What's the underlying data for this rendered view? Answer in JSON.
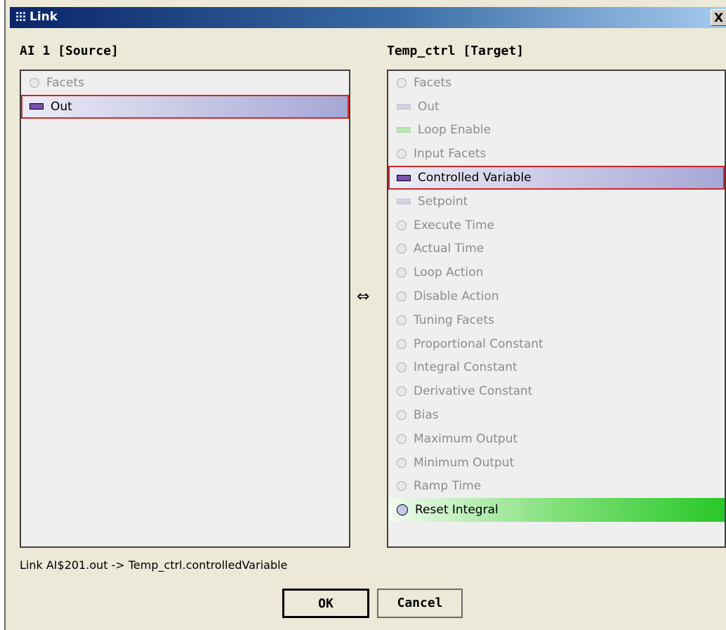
{
  "window": {
    "title": "Link",
    "close_label": "X"
  },
  "source": {
    "heading": "AI 1 [Source]",
    "items": [
      {
        "label": "Facets",
        "icon": "circle-icon",
        "state": "normal"
      },
      {
        "label": "Out",
        "icon": "bar-icon",
        "state": "selected"
      }
    ]
  },
  "link_arrow": "⇔",
  "target": {
    "heading": "Temp_ctrl [Target]",
    "items": [
      {
        "label": "Facets",
        "icon": "circle-icon",
        "state": "normal"
      },
      {
        "label": "Out",
        "icon": "bar-icon",
        "state": "normal"
      },
      {
        "label": "Loop Enable",
        "icon": "green-bar-icon",
        "state": "normal"
      },
      {
        "label": "Input Facets",
        "icon": "circle-icon",
        "state": "normal"
      },
      {
        "label": "Controlled Variable",
        "icon": "bar-icon",
        "state": "selected"
      },
      {
        "label": "Setpoint",
        "icon": "bar-icon",
        "state": "normal"
      },
      {
        "label": "Execute Time",
        "icon": "circle-icon",
        "state": "normal"
      },
      {
        "label": "Actual Time",
        "icon": "circle-icon",
        "state": "normal"
      },
      {
        "label": "Loop Action",
        "icon": "circle-icon",
        "state": "normal"
      },
      {
        "label": "Disable Action",
        "icon": "circle-icon",
        "state": "normal"
      },
      {
        "label": "Tuning Facets",
        "icon": "circle-icon",
        "state": "normal"
      },
      {
        "label": "Proportional Constant",
        "icon": "circle-icon",
        "state": "normal"
      },
      {
        "label": "Integral Constant",
        "icon": "circle-icon",
        "state": "normal"
      },
      {
        "label": "Derivative Constant",
        "icon": "circle-icon",
        "state": "normal"
      },
      {
        "label": "Bias",
        "icon": "circle-icon",
        "state": "normal"
      },
      {
        "label": "Maximum Output",
        "icon": "circle-icon",
        "state": "normal"
      },
      {
        "label": "Minimum Output",
        "icon": "circle-icon",
        "state": "normal"
      },
      {
        "label": "Ramp Time",
        "icon": "circle-icon",
        "state": "normal"
      },
      {
        "label": "Reset Integral",
        "icon": "circle-icon",
        "state": "highlight-green"
      }
    ]
  },
  "status": {
    "link_text": "Link AI$201.out -> Temp_ctrl.controlledVariable"
  },
  "buttons": {
    "ok": "OK",
    "cancel": "Cancel"
  },
  "colors": {
    "selection_border": "#d22626",
    "title_bar_start": "#0a246a",
    "green_highlight": "#28c828"
  }
}
